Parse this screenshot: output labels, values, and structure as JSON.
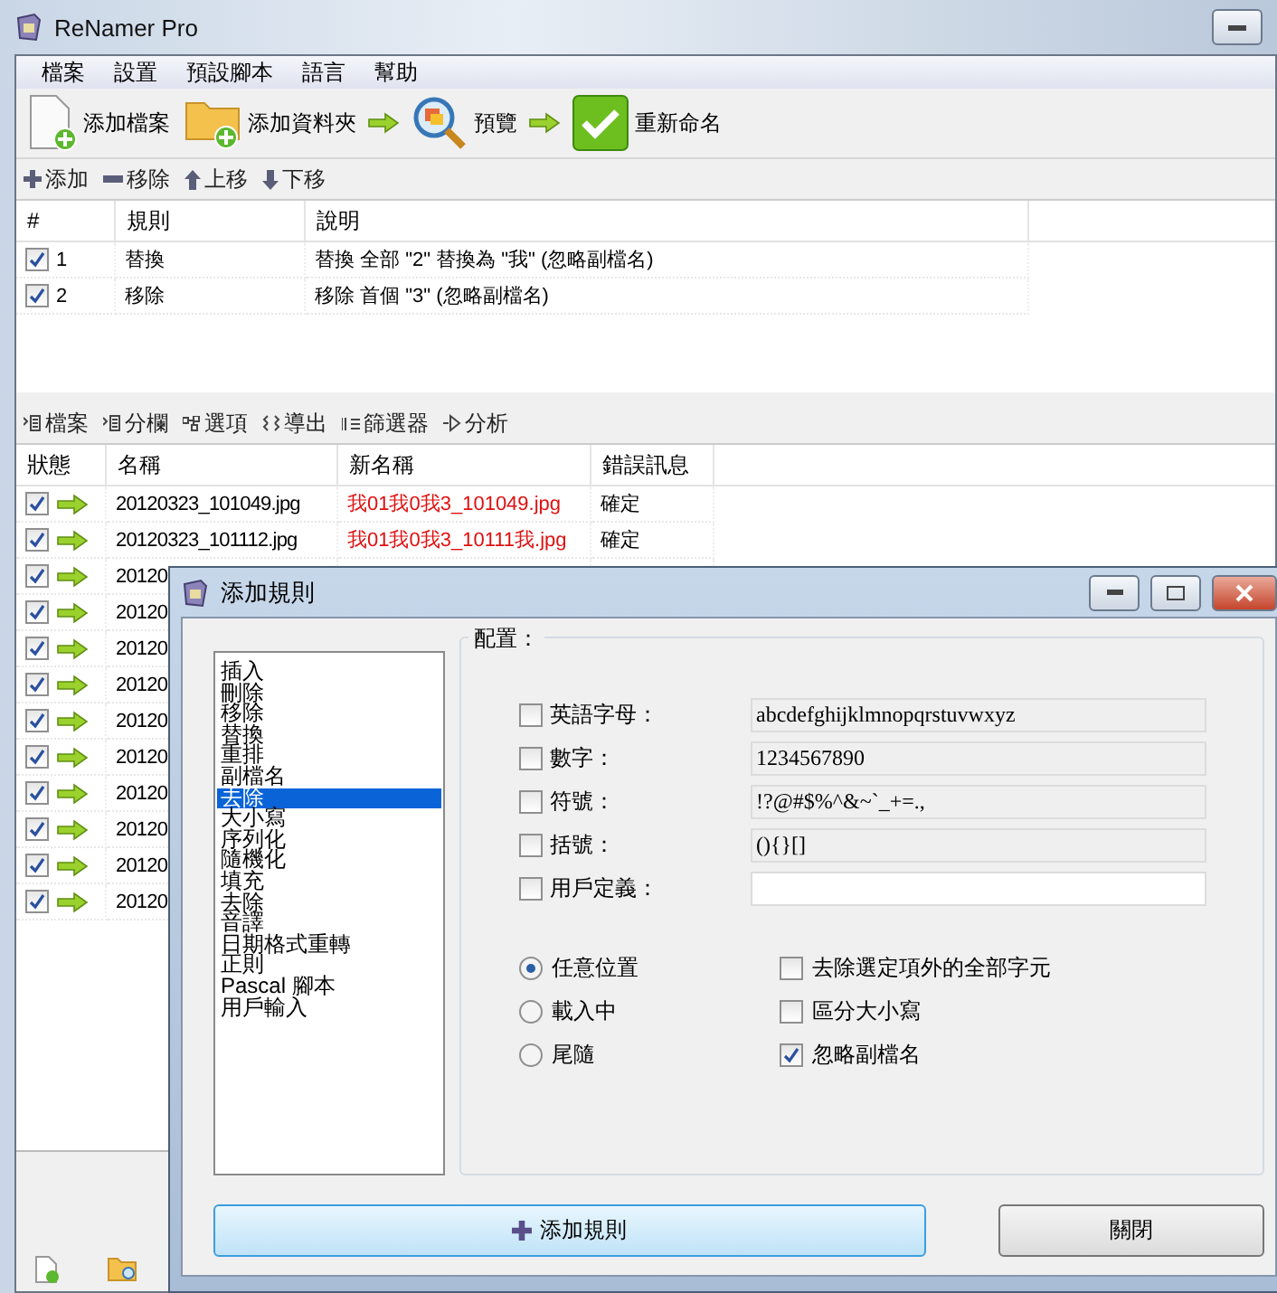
{
  "window": {
    "title": "ReNamer Pro"
  },
  "menu": [
    "檔案",
    "設置",
    "預設腳本",
    "語言",
    "幫助"
  ],
  "toolbar": [
    {
      "kind": "add-file",
      "label": "添加檔案"
    },
    {
      "kind": "add-folder",
      "label": "添加資料夾"
    },
    {
      "kind": "preview",
      "label": "預覽"
    },
    {
      "kind": "rename",
      "label": "重新命名"
    }
  ],
  "rules_toolbar": [
    {
      "kind": "add",
      "label": "添加"
    },
    {
      "kind": "remove",
      "label": "移除"
    },
    {
      "kind": "up",
      "label": "上移"
    },
    {
      "kind": "down",
      "label": "下移"
    }
  ],
  "rules_table": {
    "columns": [
      "#",
      "規則",
      "說明"
    ],
    "rows": [
      {
        "checked": true,
        "index": "1",
        "rule": "替換",
        "description": "替換 全部 \"2\" 替換為 \"我\" (忽略副檔名)"
      },
      {
        "checked": true,
        "index": "2",
        "rule": "移除",
        "description": "移除 首個 \"3\" (忽略副檔名)"
      }
    ]
  },
  "files_toolbar": [
    {
      "kind": "files",
      "label": "檔案"
    },
    {
      "kind": "columns",
      "label": "分欄"
    },
    {
      "kind": "options",
      "label": "選項"
    },
    {
      "kind": "export",
      "label": "導出"
    },
    {
      "kind": "filter",
      "label": "篩選器"
    },
    {
      "kind": "analyze",
      "label": "分析"
    }
  ],
  "files_table": {
    "columns": [
      "狀態",
      "名稱",
      "新名稱",
      "錯誤訊息"
    ],
    "rows": [
      {
        "checked": true,
        "name": "20120323_101049.jpg",
        "new_name": "我01我0我3_101049.jpg",
        "error": "確定"
      },
      {
        "checked": true,
        "name": "20120323_101112.jpg",
        "new_name": "我01我0我3_10111我.jpg",
        "error": "確定"
      },
      {
        "checked": true,
        "name": "20120"
      },
      {
        "checked": true,
        "name": "20120"
      },
      {
        "checked": true,
        "name": "20120"
      },
      {
        "checked": true,
        "name": "20120"
      },
      {
        "checked": true,
        "name": "20120"
      },
      {
        "checked": true,
        "name": "20120"
      },
      {
        "checked": true,
        "name": "20120"
      },
      {
        "checked": true,
        "name": "20120"
      },
      {
        "checked": true,
        "name": "20120"
      },
      {
        "checked": true,
        "name": "20120"
      }
    ]
  },
  "dialog": {
    "title": "添加規則",
    "rules": [
      {
        "label": "插入",
        "selected": false
      },
      {
        "label": "刪除",
        "selected": false
      },
      {
        "label": "移除",
        "selected": false
      },
      {
        "label": "替換",
        "selected": false
      },
      {
        "label": "重排",
        "selected": false
      },
      {
        "label": "副檔名",
        "selected": false
      },
      {
        "label": "去除",
        "selected": true
      },
      {
        "label": "大小寫",
        "selected": false
      },
      {
        "label": "序列化",
        "selected": false
      },
      {
        "label": "隨機化",
        "selected": false
      },
      {
        "label": "填充",
        "selected": false
      },
      {
        "label": "去除",
        "selected": false
      },
      {
        "label": "音譯",
        "selected": false
      },
      {
        "label": "日期格式重轉",
        "selected": false
      },
      {
        "label": "正則",
        "selected": false
      },
      {
        "label": "Pascal 腳本",
        "selected": false
      },
      {
        "label": "用戶輸入",
        "selected": false
      }
    ],
    "config": {
      "title": "配置：",
      "sets": [
        {
          "label": "英語字母：",
          "checked": false,
          "value": "abcdefghijklmnopqrstuvwxyz"
        },
        {
          "label": "數字：",
          "checked": false,
          "value": "1234567890"
        },
        {
          "label": "符號：",
          "checked": false,
          "value": "!?@#$%^&~`_+=.,"
        },
        {
          "label": "括號：",
          "checked": false,
          "value": "(){}[]"
        },
        {
          "label": "用戶定義：",
          "checked": false
        }
      ],
      "positions": [
        {
          "label": "任意位置",
          "selected": true
        },
        {
          "label": "載入中",
          "selected": false
        },
        {
          "label": "尾隨",
          "selected": false
        }
      ],
      "options": [
        {
          "label": "去除選定項外的全部字元",
          "checked": false
        },
        {
          "label": "區分大小寫",
          "checked": false
        },
        {
          "label": "忽略副檔名",
          "checked": true
        }
      ]
    },
    "buttons": [
      {
        "kind": "primary",
        "label": "添加規則"
      },
      {
        "kind": "secondary",
        "label": "關閉"
      }
    ]
  }
}
